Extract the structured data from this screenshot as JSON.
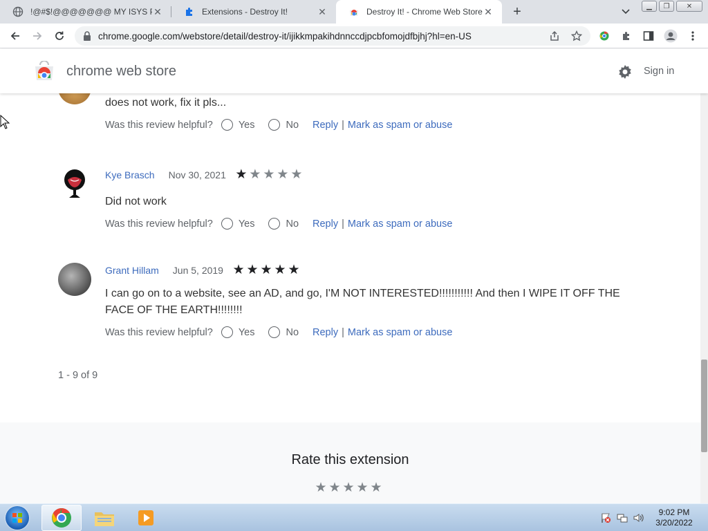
{
  "browser": {
    "tabs": [
      {
        "title": "!@#$!@@@@@@@ MY ISYS PF",
        "icon": "globe-icon",
        "active": false
      },
      {
        "title": "Extensions - Destroy It!",
        "icon": "puzzle-icon",
        "active": false
      },
      {
        "title": "Destroy It! - Chrome Web Store",
        "icon": "chrome-web-store-icon",
        "active": true
      }
    ],
    "url": "chrome.google.com/webstore/detail/destroy-it/ijikkmpakihdnnccdjpcbfomojdfbjhj?hl=en-US"
  },
  "header": {
    "title": "chrome web store",
    "signin_label": "Sign in"
  },
  "reviews": [
    {
      "name": "",
      "date": "",
      "rating": null,
      "text": "does not work, fix it pls...",
      "helpful_q": "Was this review helpful?",
      "yes": "Yes",
      "no": "No",
      "reply": "Reply",
      "spam": "Mark as spam or abuse"
    },
    {
      "name": "Kye Brasch",
      "date": "Nov 30, 2021",
      "rating": 1,
      "text": "Did not work",
      "helpful_q": "Was this review helpful?",
      "yes": "Yes",
      "no": "No",
      "reply": "Reply",
      "spam": "Mark as spam or abuse"
    },
    {
      "name": "Grant Hillam",
      "date": "Jun 5, 2019",
      "rating": 5,
      "text": "I can go on to a website, see an AD, and go, I'M NOT INTERESTED!!!!!!!!!!! And then I WIPE IT OFF THE FACE OF THE EARTH!!!!!!!!",
      "helpful_q": "Was this review helpful?",
      "yes": "Yes",
      "no": "No",
      "reply": "Reply",
      "spam": "Mark as spam or abuse"
    }
  ],
  "pager": "1 - 9 of 9",
  "rate": {
    "title": "Rate this extension",
    "stars": 5
  },
  "taskbar": {
    "time": "9:02 PM",
    "date": "3/20/2022"
  },
  "colors": {
    "link": "#3d6bbd",
    "tabstrip": "#dee1e6"
  }
}
